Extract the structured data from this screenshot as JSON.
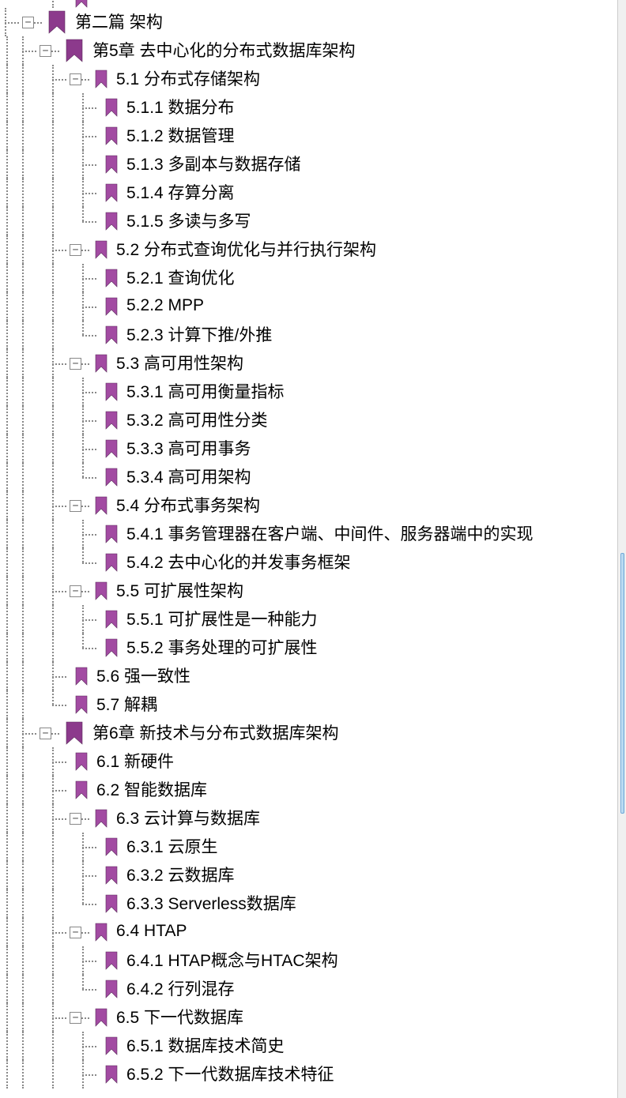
{
  "icons": {
    "bookmark_big_color": "#8c3a8c",
    "bookmark_small_color": "#a24ba2"
  },
  "toggle": {
    "minus": "−",
    "plus": "+"
  },
  "tree": [
    {
      "level": 3,
      "big": false,
      "last": false,
      "cut": true,
      "toggle": null,
      "label": ""
    },
    {
      "level": 1,
      "big": true,
      "last": false,
      "toggle": "minus",
      "label": "第二篇 架构"
    },
    {
      "level": 2,
      "big": true,
      "last": false,
      "toggle": "minus",
      "label": "第5章 去中心化的分布式数据库架构"
    },
    {
      "level": 3,
      "big": false,
      "last": false,
      "toggle": "minus",
      "label": "5.1 分布式存储架构"
    },
    {
      "level": 4,
      "big": false,
      "last": false,
      "toggle": null,
      "label": "5.1.1 数据分布"
    },
    {
      "level": 4,
      "big": false,
      "last": false,
      "toggle": null,
      "label": "5.1.2 数据管理"
    },
    {
      "level": 4,
      "big": false,
      "last": false,
      "toggle": null,
      "label": "5.1.3 多副本与数据存储"
    },
    {
      "level": 4,
      "big": false,
      "last": false,
      "toggle": null,
      "label": "5.1.4 存算分离"
    },
    {
      "level": 4,
      "big": false,
      "last": true,
      "toggle": null,
      "label": "5.1.5 多读与多写"
    },
    {
      "level": 3,
      "big": false,
      "last": false,
      "toggle": "minus",
      "label": "5.2 分布式查询优化与并行执行架构"
    },
    {
      "level": 4,
      "big": false,
      "last": false,
      "toggle": null,
      "label": "5.2.1 查询优化"
    },
    {
      "level": 4,
      "big": false,
      "last": false,
      "toggle": null,
      "label": "5.2.2 MPP"
    },
    {
      "level": 4,
      "big": false,
      "last": true,
      "toggle": null,
      "label": "5.2.3 计算下推/外推"
    },
    {
      "level": 3,
      "big": false,
      "last": false,
      "toggle": "minus",
      "label": "5.3 高可用性架构"
    },
    {
      "level": 4,
      "big": false,
      "last": false,
      "toggle": null,
      "label": "5.3.1 高可用衡量指标"
    },
    {
      "level": 4,
      "big": false,
      "last": false,
      "toggle": null,
      "label": "5.3.2 高可用性分类"
    },
    {
      "level": 4,
      "big": false,
      "last": false,
      "toggle": null,
      "label": "5.3.3 高可用事务"
    },
    {
      "level": 4,
      "big": false,
      "last": true,
      "toggle": null,
      "label": "5.3.4 高可用架构"
    },
    {
      "level": 3,
      "big": false,
      "last": false,
      "toggle": "minus",
      "label": "5.4 分布式事务架构"
    },
    {
      "level": 4,
      "big": false,
      "last": false,
      "toggle": null,
      "label": "5.4.1 事务管理器在客户端、中间件、服务器端中的实现"
    },
    {
      "level": 4,
      "big": false,
      "last": true,
      "toggle": null,
      "label": "5.4.2 去中心化的并发事务框架"
    },
    {
      "level": 3,
      "big": false,
      "last": false,
      "toggle": "minus",
      "label": "5.5 可扩展性架构"
    },
    {
      "level": 4,
      "big": false,
      "last": false,
      "toggle": null,
      "label": "5.5.1 可扩展性是一种能力"
    },
    {
      "level": 4,
      "big": false,
      "last": true,
      "toggle": null,
      "label": "5.5.2 事务处理的可扩展性"
    },
    {
      "level": 3,
      "big": false,
      "last": false,
      "toggle": null,
      "label": "5.6 强一致性"
    },
    {
      "level": 3,
      "big": false,
      "last": true,
      "toggle": null,
      "label": "5.7 解耦"
    },
    {
      "level": 2,
      "big": true,
      "last": false,
      "toggle": "minus",
      "label": "第6章 新技术与分布式数据库架构"
    },
    {
      "level": 3,
      "big": false,
      "last": false,
      "toggle": null,
      "label": "6.1 新硬件"
    },
    {
      "level": 3,
      "big": false,
      "last": false,
      "toggle": null,
      "label": "6.2 智能数据库"
    },
    {
      "level": 3,
      "big": false,
      "last": false,
      "toggle": "minus",
      "label": "6.3 云计算与数据库"
    },
    {
      "level": 4,
      "big": false,
      "last": false,
      "toggle": null,
      "label": "6.3.1 云原生"
    },
    {
      "level": 4,
      "big": false,
      "last": false,
      "toggle": null,
      "label": "6.3.2 云数据库"
    },
    {
      "level": 4,
      "big": false,
      "last": true,
      "toggle": null,
      "label": "6.3.3 Serverless数据库"
    },
    {
      "level": 3,
      "big": false,
      "last": false,
      "toggle": "minus",
      "label": "6.4 HTAP"
    },
    {
      "level": 4,
      "big": false,
      "last": false,
      "toggle": null,
      "label": "6.4.1 HTAP概念与HTAC架构"
    },
    {
      "level": 4,
      "big": false,
      "last": true,
      "toggle": null,
      "label": "6.4.2 行列混存"
    },
    {
      "level": 3,
      "big": false,
      "last": false,
      "toggle": "minus",
      "label": "6.5 下一代数据库"
    },
    {
      "level": 4,
      "big": false,
      "last": false,
      "toggle": null,
      "label": "6.5.1 数据库技术简史"
    },
    {
      "level": 4,
      "big": false,
      "last": false,
      "toggle": null,
      "label": "6.5.2 下一代数据库技术特征"
    }
  ]
}
